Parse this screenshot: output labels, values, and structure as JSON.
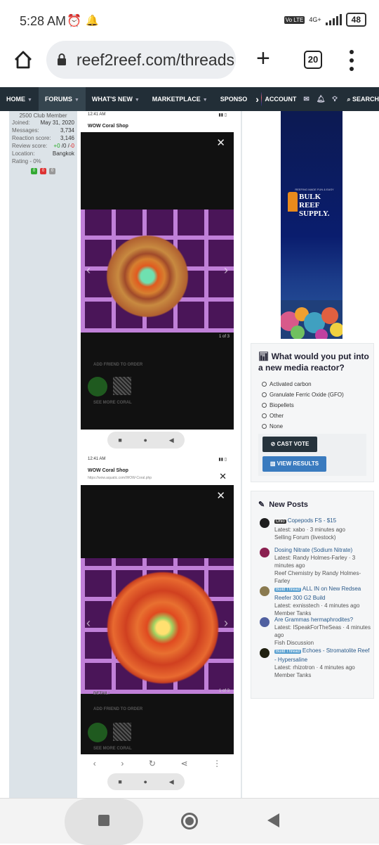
{
  "status_bar": {
    "time": "5:28 AM",
    "network": "4G+",
    "volte": "Vo LTE",
    "battery": "48"
  },
  "browser": {
    "url": "reef2reef.com/threads",
    "tab_count": "20"
  },
  "nav": {
    "items": [
      {
        "label": "HOME"
      },
      {
        "label": "FORUMS"
      },
      {
        "label": "WHAT'S NEW"
      },
      {
        "label": "MARKETPLACE"
      },
      {
        "label": "SPONSO"
      }
    ],
    "account": "ACCOUNT",
    "search": "SEARCH"
  },
  "member": {
    "rank": "2500 Club Member",
    "rows": [
      {
        "k": "Joined:",
        "v": "May 31, 2020"
      },
      {
        "k": "Messages:",
        "v": "3,734"
      },
      {
        "k": "Reaction score:",
        "v": "3,146"
      },
      {
        "k": "Location:",
        "v": "Bangkok"
      }
    ],
    "review_label": "Review score:",
    "review_pos": "+0",
    "review_mid": " /0 /",
    "review_neg": "-0",
    "rating": "Rating - 0%",
    "badges": [
      "0",
      "0",
      "0"
    ]
  },
  "screenshots": [
    {
      "time": "12:41 AM",
      "title": "WOW Coral Shop",
      "count": "1 of 3",
      "add_friend": "ADD FRIEND TO ORDER",
      "see_more": "SEE MORE CORAL"
    },
    {
      "time": "12:41 AM",
      "title": "WOW Coral Shop",
      "url": "https://wow.aquatic.com/WOW-Coral.php",
      "count": "1 of 3",
      "detail": "DETAIL:",
      "add_friend": "ADD FRIEND TO ORDER",
      "see_more": "SEE MORE CORAL"
    }
  ],
  "ad": {
    "tagline": "REEFING MADE FUN & EASY",
    "brand_line1": "BULK REEF",
    "brand_line2": "SUPPLY."
  },
  "poll": {
    "title": "What would you put into a new media reactor?",
    "options": [
      "Activated carbon",
      "Granulate Ferric Oxide (GFO)",
      "Biopellets",
      "Other",
      "None"
    ],
    "cast_vote": "CAST VOTE",
    "view_results": "VIEW RESULTS"
  },
  "new_posts": {
    "title": "New Posts",
    "items": [
      {
        "prefix": "Ohio",
        "prefix_color": "#333333",
        "title": "Copepods FS - $15",
        "latest": "Latest: xabo · 3 minutes ago",
        "forum": "Selling Forum (livestock)",
        "avatar_color": "#1e1e1e"
      },
      {
        "prefix": "",
        "prefix_color": "",
        "title": "Dosing Nitrate (Sodium Nitrate)",
        "latest": "Latest: Randy Holmes-Farley · 3 minutes ago",
        "forum": "Reef Chemistry by Randy Holmes-Farley",
        "avatar_color": "#8a2050"
      },
      {
        "prefix": "Build Thread",
        "prefix_color": "#5aa0d0",
        "title": "ALL IN on New Redsea Reefer 300 G2 Build",
        "latest": "Latest: exnisstech · 4 minutes ago",
        "forum": "Member Tanks",
        "avatar_color": "#8a7a50"
      },
      {
        "prefix": "",
        "prefix_color": "",
        "title": "Are Grammas hermaphrodites?",
        "latest": "Latest: ISpeakForTheSeas · 4 minutes ago",
        "forum": "Fish Discussion",
        "avatar_color": "#5060a0"
      },
      {
        "prefix": "Build Thread",
        "prefix_color": "#5aa0d0",
        "title": "Echoes - Stromatolite Reef - Hypersaline",
        "latest": "Latest: rhizotron · 4 minutes ago",
        "forum": "Member Tanks",
        "avatar_color": "#202010"
      }
    ]
  }
}
